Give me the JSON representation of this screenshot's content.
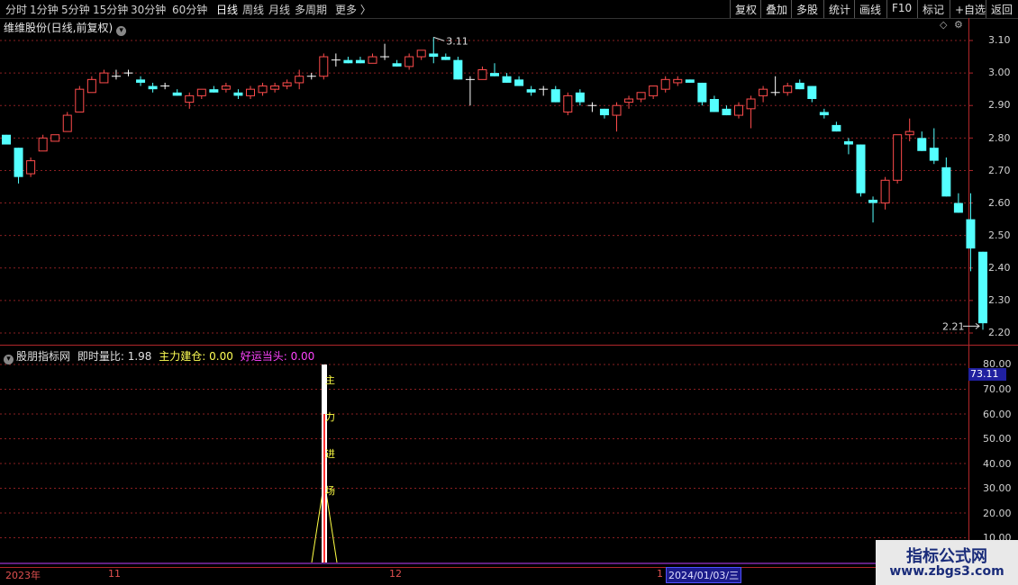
{
  "toolbar": {
    "left": [
      "分时",
      "1分钟",
      "5分钟",
      "15分钟",
      "30分钟",
      "60分钟",
      "日线",
      "周线",
      "月线",
      "多周期",
      "更多 〉"
    ],
    "right": [
      "复权",
      "叠加",
      "多股",
      "统计",
      "画线",
      "F10",
      "标记",
      "+自选",
      "返回"
    ],
    "active": "日线"
  },
  "chart_title": "维维股份(日线,前复权)",
  "main_axis": [
    "3.10",
    "3.00",
    "2.90",
    "2.80",
    "2.70",
    "2.60",
    "2.50",
    "2.40",
    "2.30",
    "2.20"
  ],
  "annotations": {
    "high": "3.11",
    "low": "2.21"
  },
  "sub_legend": {
    "name": "股朋指标网",
    "ratio_label": "即时量比:",
    "ratio_value": "1.98",
    "main_label": "主力建仓:",
    "main_value": "0.00",
    "luck_label": "好运当头:",
    "luck_value": "0.00"
  },
  "signal_text": [
    "主",
    "力",
    "进",
    "场"
  ],
  "sub_axis": [
    "80.00",
    "70.00",
    "60.00",
    "50.00",
    "40.00",
    "30.00",
    "20.00",
    "10.00"
  ],
  "sub_value_tag": "73.11",
  "dates": {
    "year": "2023年",
    "m11": "11",
    "m12": "12",
    "m1": "1",
    "cursor": "2024/01/03/三"
  },
  "watermark": {
    "line1": "指标公式网",
    "line2": "www.zbgs3.com"
  },
  "colors": {
    "up": "#ff4c4c",
    "down": "#54ffff",
    "border": "#b0262a",
    "grid": "#8a1f22"
  },
  "chart_data": {
    "type": "candlestick",
    "ylim": [
      2.18,
      3.13
    ],
    "candles": [
      [
        2.81,
        2.81,
        2.78,
        2.78
      ],
      [
        2.77,
        2.77,
        2.66,
        2.68
      ],
      [
        2.69,
        2.74,
        2.68,
        2.73
      ],
      [
        2.76,
        2.81,
        2.76,
        2.8
      ],
      [
        2.79,
        2.81,
        2.79,
        2.81
      ],
      [
        2.82,
        2.88,
        2.82,
        2.87
      ],
      [
        2.88,
        2.96,
        2.88,
        2.95
      ],
      [
        2.94,
        2.99,
        2.94,
        2.98
      ],
      [
        2.97,
        3.01,
        2.97,
        3.0
      ],
      [
        2.99,
        3.01,
        2.98,
        2.99
      ],
      [
        3.0,
        3.01,
        2.99,
        3.0
      ],
      [
        2.98,
        2.99,
        2.96,
        2.97
      ],
      [
        2.96,
        2.97,
        2.94,
        2.95
      ],
      [
        2.96,
        2.97,
        2.95,
        2.96
      ],
      [
        2.94,
        2.95,
        2.93,
        2.93
      ],
      [
        2.91,
        2.94,
        2.89,
        2.93
      ],
      [
        2.93,
        2.95,
        2.92,
        2.95
      ],
      [
        2.95,
        2.96,
        2.94,
        2.94
      ],
      [
        2.95,
        2.97,
        2.94,
        2.96
      ],
      [
        2.94,
        2.95,
        2.92,
        2.93
      ],
      [
        2.93,
        2.96,
        2.92,
        2.95
      ],
      [
        2.94,
        2.97,
        2.93,
        2.96
      ],
      [
        2.95,
        2.97,
        2.94,
        2.96
      ],
      [
        2.96,
        2.98,
        2.95,
        2.97
      ],
      [
        2.97,
        3.01,
        2.95,
        2.99
      ],
      [
        2.99,
        3.0,
        2.98,
        2.99
      ],
      [
        2.99,
        3.06,
        2.98,
        3.05
      ],
      [
        3.04,
        3.06,
        3.02,
        3.04
      ],
      [
        3.04,
        3.05,
        3.03,
        3.03
      ],
      [
        3.04,
        3.05,
        3.03,
        3.03
      ],
      [
        3.03,
        3.06,
        3.03,
        3.05
      ],
      [
        3.05,
        3.09,
        3.04,
        3.05
      ],
      [
        3.03,
        3.04,
        3.02,
        3.02
      ],
      [
        3.02,
        3.06,
        3.01,
        3.05
      ],
      [
        3.05,
        3.07,
        3.04,
        3.07
      ],
      [
        3.06,
        3.11,
        3.03,
        3.05
      ],
      [
        3.05,
        3.06,
        3.04,
        3.04
      ],
      [
        3.04,
        3.05,
        2.98,
        2.98
      ],
      [
        2.98,
        2.99,
        2.9,
        2.98
      ],
      [
        2.98,
        3.02,
        2.98,
        3.01
      ],
      [
        3.0,
        3.03,
        2.99,
        2.99
      ],
      [
        2.99,
        3.0,
        2.97,
        2.97
      ],
      [
        2.98,
        2.99,
        2.96,
        2.96
      ],
      [
        2.95,
        2.96,
        2.93,
        2.94
      ],
      [
        2.95,
        2.96,
        2.93,
        2.95
      ],
      [
        2.95,
        2.96,
        2.91,
        2.91
      ],
      [
        2.88,
        2.94,
        2.87,
        2.93
      ],
      [
        2.94,
        2.95,
        2.9,
        2.91
      ],
      [
        2.9,
        2.91,
        2.88,
        2.9
      ],
      [
        2.89,
        2.89,
        2.86,
        2.87
      ],
      [
        2.87,
        2.91,
        2.82,
        2.9
      ],
      [
        2.91,
        2.93,
        2.89,
        2.92
      ],
      [
        2.92,
        2.94,
        2.91,
        2.94
      ],
      [
        2.93,
        2.96,
        2.92,
        2.96
      ],
      [
        2.95,
        2.99,
        2.94,
        2.98
      ],
      [
        2.97,
        2.99,
        2.96,
        2.98
      ],
      [
        2.98,
        2.98,
        2.97,
        2.97
      ],
      [
        2.97,
        2.97,
        2.9,
        2.91
      ],
      [
        2.92,
        2.93,
        2.88,
        2.88
      ],
      [
        2.89,
        2.9,
        2.87,
        2.87
      ],
      [
        2.87,
        2.91,
        2.86,
        2.9
      ],
      [
        2.89,
        2.93,
        2.83,
        2.92
      ],
      [
        2.93,
        2.96,
        2.91,
        2.95
      ],
      [
        2.94,
        2.99,
        2.93,
        2.94
      ],
      [
        2.94,
        2.97,
        2.93,
        2.96
      ],
      [
        2.97,
        2.98,
        2.95,
        2.95
      ],
      [
        2.96,
        2.96,
        2.91,
        2.92
      ],
      [
        2.88,
        2.89,
        2.86,
        2.87
      ],
      [
        2.84,
        2.85,
        2.82,
        2.82
      ],
      [
        2.79,
        2.8,
        2.75,
        2.78
      ],
      [
        2.78,
        2.78,
        2.62,
        2.63
      ],
      [
        2.61,
        2.62,
        2.54,
        2.6
      ],
      [
        2.6,
        2.68,
        2.58,
        2.67
      ],
      [
        2.67,
        2.81,
        2.66,
        2.81
      ],
      [
        2.81,
        2.86,
        2.79,
        2.82
      ],
      [
        2.8,
        2.82,
        2.76,
        2.76
      ],
      [
        2.77,
        2.83,
        2.72,
        2.73
      ],
      [
        2.71,
        2.74,
        2.62,
        2.62
      ],
      [
        2.6,
        2.63,
        2.57,
        2.57
      ],
      [
        2.55,
        2.63,
        2.39,
        2.46
      ],
      [
        2.45,
        2.45,
        2.21,
        2.23
      ]
    ]
  }
}
